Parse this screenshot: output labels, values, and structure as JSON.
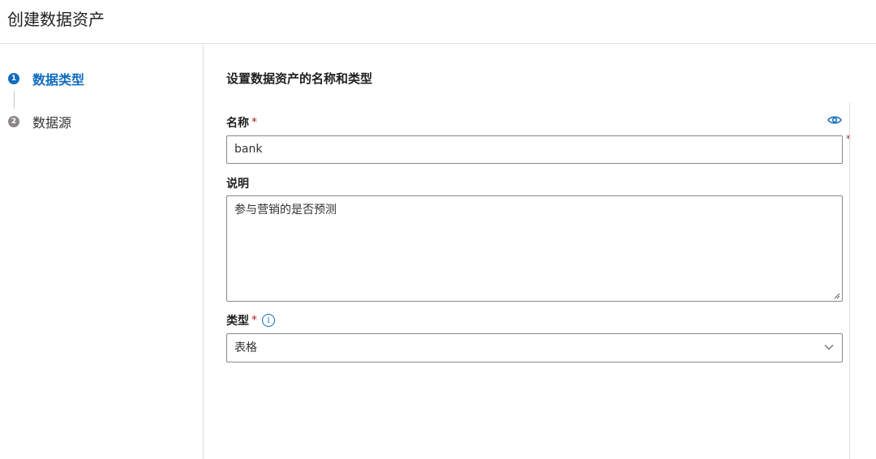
{
  "page": {
    "title": "创建数据资产"
  },
  "steps": [
    {
      "number": "1",
      "label": "数据类型",
      "state": "active"
    },
    {
      "number": "2",
      "label": "数据源",
      "state": "inactive"
    }
  ],
  "form": {
    "section_title": "设置数据资产的名称和类型",
    "name": {
      "label": "名称",
      "required_mark": "*",
      "value": "bank",
      "icon": "eye-icon"
    },
    "description": {
      "label": "说明",
      "value": "参与营销的是否预测"
    },
    "type": {
      "label": "类型",
      "required_mark": "*",
      "info_icon": "i",
      "value": "表格",
      "icon": "chevron-down-icon"
    },
    "outer_required_mark": "*"
  },
  "colors": {
    "accent": "#0f6cbd",
    "required": "#a4262c",
    "border": "#8a8886",
    "divider": "#e1dfdd"
  }
}
